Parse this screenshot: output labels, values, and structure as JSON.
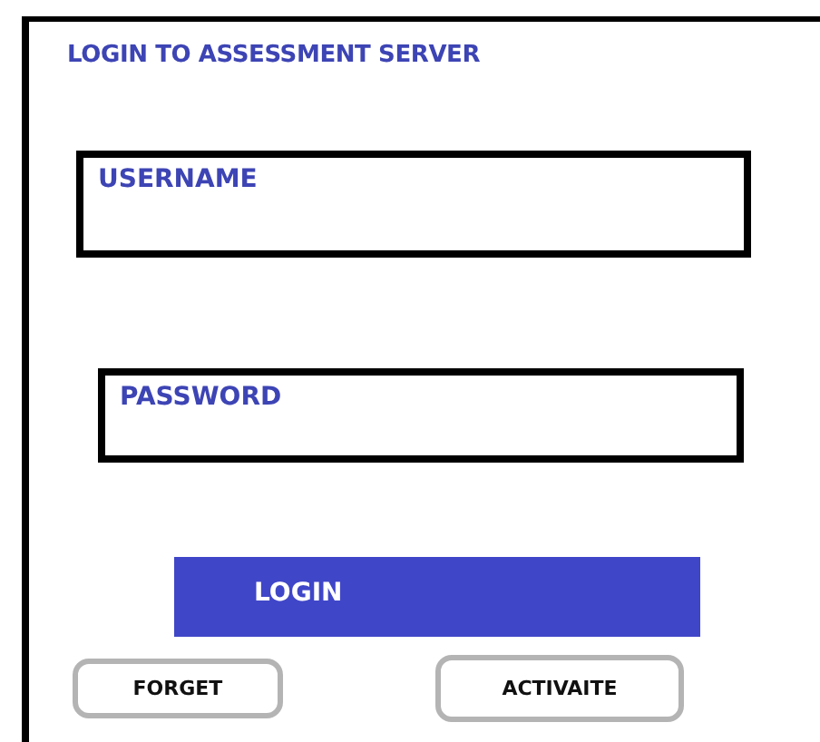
{
  "title": "LOGIN TO ASSESSMENT SERVER",
  "fields": [
    {
      "placeholder": "USERNAME"
    },
    {
      "placeholder": "PASSWORD"
    }
  ],
  "login_button": "LOGIN",
  "buttons": [
    "FORGET",
    "ACTIVAITE"
  ]
}
